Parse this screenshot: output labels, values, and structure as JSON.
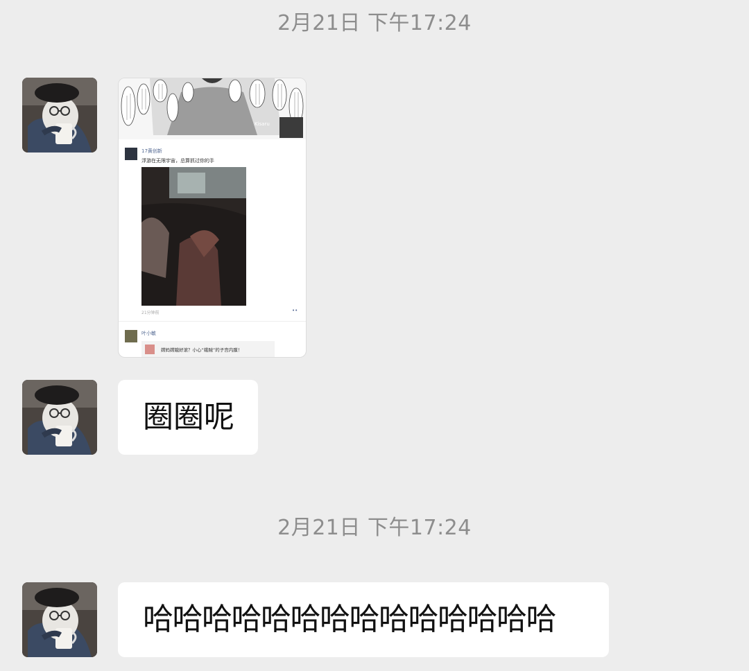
{
  "chat": {
    "timestamp_1": "2月21日 下午17:24",
    "timestamp_2": "2月21日 下午17:24",
    "message_2": "圈圈呢",
    "message_3": "哈哈哈哈哈哈哈哈哈哈哈哈哈哈"
  },
  "shared_moment": {
    "cover_watermark": "Kisaru",
    "post_author": "17黄创新",
    "post_text": "浮游在无限宇宙，总算抓过你的手",
    "post_time": "21分钟前",
    "more_dots": "••",
    "commenter": "叶小敏",
    "link_text": "嫦妈嫦娥好滚？小心“蛾贼”的子宫内膜！"
  },
  "colors": {
    "background": "#ededed",
    "bubble": "#ffffff",
    "timestamp": "#8d8d8d",
    "name_link": "#566b94"
  }
}
